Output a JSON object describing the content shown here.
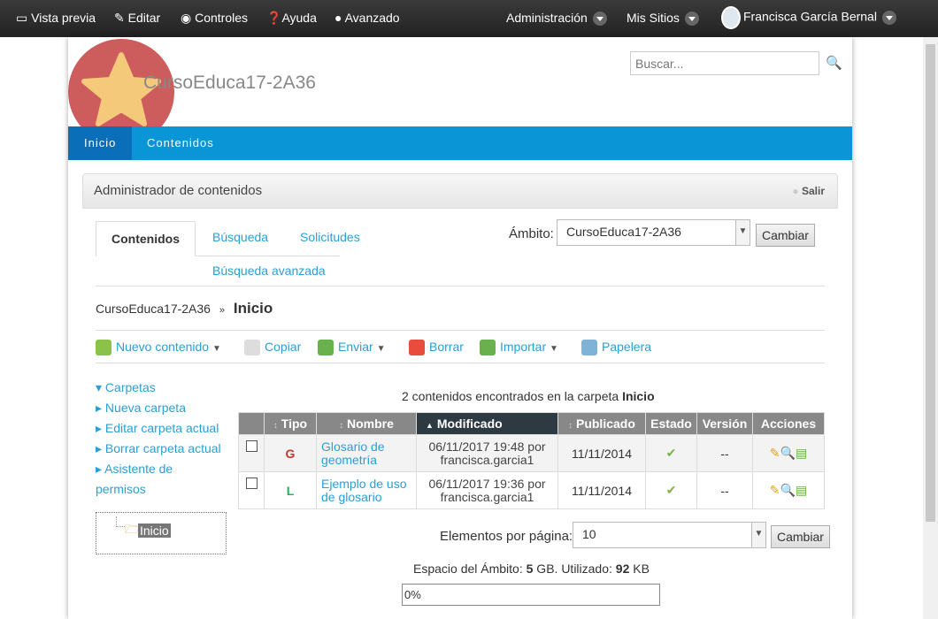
{
  "topbar": {
    "items": [
      "Vista previa",
      "Editar",
      "Controles",
      "Ayuda",
      "Avanzado"
    ],
    "admin": "Administración",
    "sites": "Mis Sitios",
    "user": "Francisca García Bernal"
  },
  "header": {
    "site_title": "CursoEduca17-2A36",
    "search_placeholder": "Buscar..."
  },
  "nav": [
    "Inicio",
    "Contenidos"
  ],
  "panel": {
    "title": "Administrador de contenidos",
    "exit": "Salir"
  },
  "tabs": [
    "Contenidos",
    "Búsqueda",
    "Solicitudes",
    "Búsqueda avanzada"
  ],
  "scope": {
    "label": "Ámbito:",
    "value": "CursoEduca17-2A36",
    "button": "Cambiar"
  },
  "breadcrumb": {
    "root": "CursoEduca17-2A36",
    "sep": "»",
    "current": "Inicio"
  },
  "toolbar": [
    "Nuevo contenido",
    "Copiar",
    "Enviar",
    "Borrar",
    "Importar",
    "Papelera"
  ],
  "sidebar": {
    "folders": "Carpetas",
    "links": [
      "Nueva carpeta",
      "Editar carpeta actual",
      "Borrar carpeta actual",
      "Asistente de permisos"
    ],
    "tree_node": "Inicio"
  },
  "summary": {
    "text": "2 contenidos encontrados en la carpeta ",
    "folder": "Inicio"
  },
  "table": {
    "headers": [
      "Tipo",
      "Nombre",
      "Modificado",
      "Publicado",
      "Estado",
      "Versión",
      "Acciones"
    ],
    "rows": [
      {
        "type": "G",
        "name": "Glosario de geometría",
        "modified": "06/11/2017 19:48 por",
        "by": "francisca.garcia1",
        "published": "11/11/2014",
        "version": "--"
      },
      {
        "type": "L",
        "name": "Ejemplo de uso de glosario",
        "modified": "06/11/2017 19:36 por",
        "by": "francisca.garcia1",
        "published": "11/11/2014",
        "version": "--"
      }
    ]
  },
  "pagination": {
    "label": "Elementos por página:",
    "value": "10",
    "button": "Cambiar"
  },
  "quota": {
    "prefix": "Espacio del Ámbito: ",
    "total": "5",
    "mid": " GB. Utilizado: ",
    "used": "92",
    "unit": " KB",
    "progress": "0%"
  }
}
